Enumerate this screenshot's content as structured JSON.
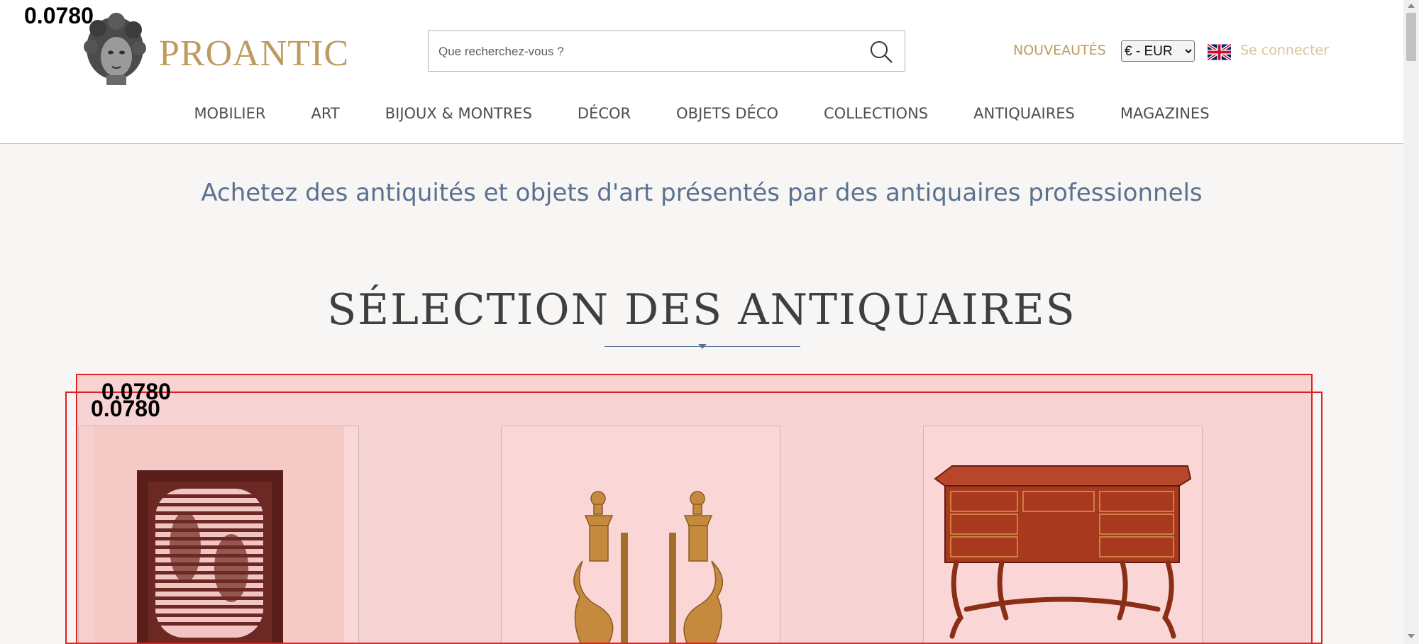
{
  "header": {
    "logo_text": "PROANTIC",
    "search": {
      "placeholder": "Que recherchez-vous ?"
    },
    "nouveautes_label": "NOUVEAUTÉS",
    "currency": {
      "selected": "€ - EUR"
    },
    "language_flag": "uk-flag-icon",
    "login_label": "Se connecter"
  },
  "nav": {
    "items": [
      {
        "label": "MOBILIER"
      },
      {
        "label": "ART"
      },
      {
        "label": "BIJOUX & MONTRES"
      },
      {
        "label": "DÉCOR"
      },
      {
        "label": "OBJETS DÉCO"
      },
      {
        "label": "COLLECTIONS"
      },
      {
        "label": "ANTIQUAIRES"
      },
      {
        "label": "MAGAZINES"
      }
    ]
  },
  "main": {
    "tagline": "Achetez des antiquités et objets d'art présentés par des antiquaires professionnels",
    "section_title": "SÉLECTION DES ANTIQUAIRES",
    "products": [
      {
        "image": "framed-op-art-face-print"
      },
      {
        "image": "gilt-bronze-andirons"
      },
      {
        "image": "boulle-marquetry-desk"
      }
    ]
  },
  "overlay": {
    "scores": [
      "0.0780",
      "0.0780",
      "0.0780"
    ]
  },
  "colors": {
    "gold": "#bd9b5e",
    "nav_text": "#4a4d52",
    "tagline_blue": "#5a7190",
    "selection_bg": "#f8d3d4",
    "overlay_red": "#e02020"
  }
}
